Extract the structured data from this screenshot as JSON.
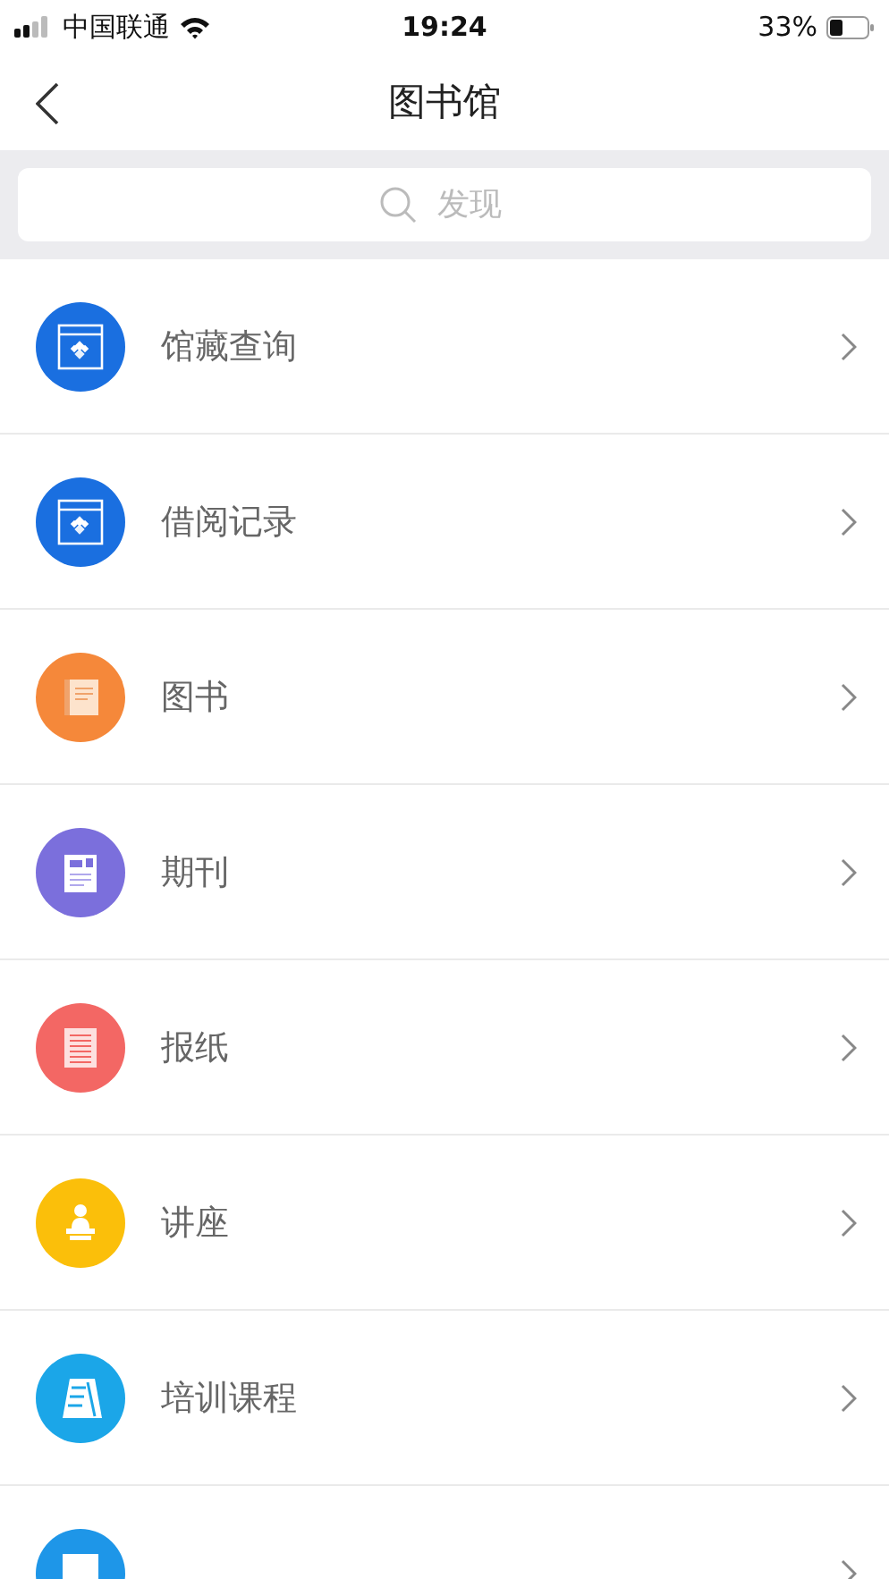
{
  "status_bar": {
    "carrier": "中国联通",
    "time": "19:24",
    "battery": "33%"
  },
  "nav": {
    "title": "图书馆"
  },
  "search": {
    "placeholder": "发现"
  },
  "items": [
    {
      "label": "馆藏查询",
      "kind": "catalog",
      "color": "#1a6fe0"
    },
    {
      "label": "借阅记录",
      "kind": "catalog",
      "color": "#1a6fe0"
    },
    {
      "label": "图书",
      "kind": "book",
      "color": "#f5883a"
    },
    {
      "label": "期刊",
      "kind": "magazine",
      "color": "#7b6fdc"
    },
    {
      "label": "报纸",
      "kind": "newspaper",
      "color": "#f36764"
    },
    {
      "label": "讲座",
      "kind": "lecture",
      "color": "#fbbf0a"
    },
    {
      "label": "培训课程",
      "kind": "course",
      "color": "#1ba6e8"
    },
    {
      "kind": "board",
      "color": "#1e96e8"
    }
  ]
}
